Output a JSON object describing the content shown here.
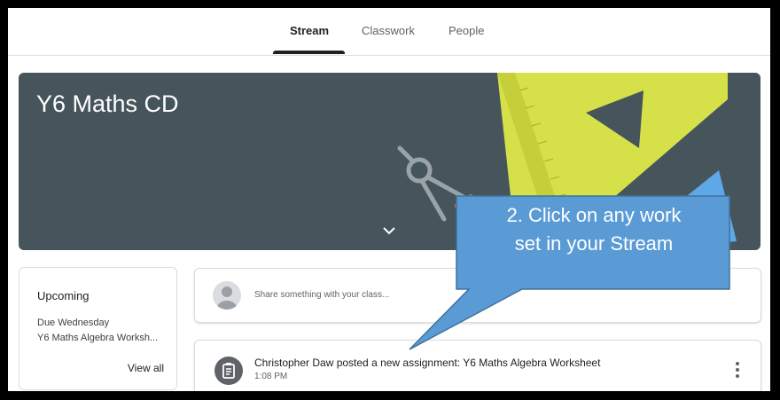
{
  "nav": {
    "tabs": [
      {
        "label": "Stream",
        "active": true
      },
      {
        "label": "Classwork",
        "active": false
      },
      {
        "label": "People",
        "active": false
      }
    ]
  },
  "banner": {
    "title": "Y6 Maths CD",
    "background_color": "#46555c"
  },
  "upcoming": {
    "title": "Upcoming",
    "due_label": "Due Wednesday",
    "item": "Y6 Maths Algebra Worksh...",
    "view_all": "View all"
  },
  "share": {
    "placeholder": "Share something with your class..."
  },
  "post": {
    "title": "Christopher Daw posted a new assignment: Y6 Maths Algebra Worksheet",
    "time": "1:08 PM",
    "icon": "assignment-icon"
  },
  "callout": {
    "line1": "2. Click on any work",
    "line2": "set in your Stream",
    "color": "#5b9bd5"
  }
}
